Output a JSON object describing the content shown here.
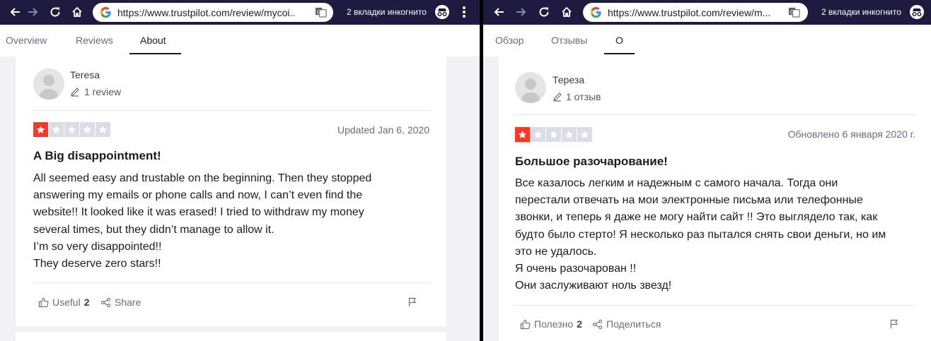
{
  "left": {
    "url": "https://www.trustpilot.com/review/mycoi...",
    "incognito_label": "2 вкладки инкогнито",
    "tabs": [
      "Overview",
      "Reviews",
      "About"
    ],
    "active_tab": "About",
    "reviewer": {
      "name": "Teresa",
      "review_count": "1 review"
    },
    "rating": 1,
    "date": "Updated Jan 6, 2020",
    "title": "A Big disappointment!",
    "body": [
      "All seemed easy and trustable on the beginning. Then they stopped",
      "answering my emails or phone calls and now, I can’t even find the",
      "website!! It looked like it was erased! I tried to withdraw my money",
      "several times, but they didn’t manage to allow it.",
      "I’m so very disappointed!!",
      "They deserve zero stars!!"
    ],
    "useful_label": "Useful",
    "useful_count": "2",
    "share_label": "Share"
  },
  "right": {
    "url": "https://www.trustpilot.com/review/m...",
    "incognito_label": "2 вкладки инкогнито",
    "tabs": [
      "Обзор",
      "Отзывы",
      "О"
    ],
    "active_tab": "О",
    "reviewer": {
      "name": "Тереза",
      "review_count": "1 отзыв"
    },
    "rating": 1,
    "date": "Обновлено 6 января 2020 г.",
    "title": "Большое разочарование!",
    "body": [
      "Все казалось легким и надежным с самого начала. Тогда они",
      "перестали отвечать на мои электронные письма или телефонные",
      "звонки, и теперь я даже не могу найти сайт !! Это выглядело так, как",
      "будто было стерто! Я несколько раз пытался снять свои деньги, но им",
      "это не удалось.",
      "Я очень разочарован !!",
      "Они заслуживают ноль звезд!"
    ],
    "useful_label": "Полезно",
    "useful_count": "2",
    "share_label": "Поделиться"
  },
  "colors": {
    "toolbar": "#1f1a3f",
    "star_filled": "#ff3722",
    "star_empty": "#dcdce6",
    "page_bg": "#f1f1f6"
  },
  "icons": {
    "back": "arrow-left-icon",
    "forward": "arrow-right-icon",
    "reload": "reload-icon",
    "home": "home-icon",
    "google": "google-g-icon",
    "translate": "translate-icon",
    "incognito": "incognito-icon",
    "menu": "kebab-menu-icon",
    "avatar": "avatar-icon",
    "pencil": "pencil-icon",
    "star": "star-icon",
    "thumbs_up": "thumbs-up-icon",
    "share": "share-icon",
    "flag": "flag-icon"
  }
}
